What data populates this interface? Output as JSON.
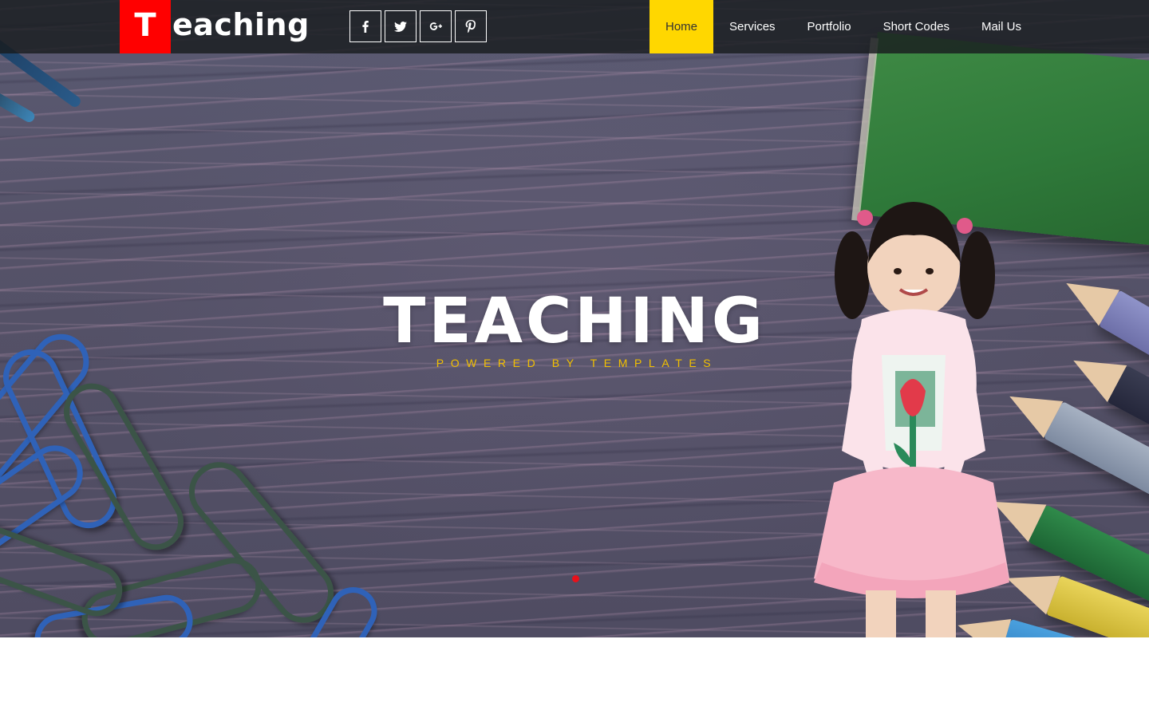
{
  "brand": {
    "logo_initial": "T",
    "logo_rest": "eaching",
    "accent_color": "#ff0000"
  },
  "social": [
    {
      "name": "facebook-icon",
      "label": "f"
    },
    {
      "name": "twitter-icon",
      "label": ""
    },
    {
      "name": "google-plus-icon",
      "label": "g+"
    },
    {
      "name": "pinterest-icon",
      "label": ""
    }
  ],
  "nav": {
    "items": [
      {
        "label": "Home",
        "active": true
      },
      {
        "label": "Services",
        "active": false
      },
      {
        "label": "Portfolio",
        "active": false
      },
      {
        "label": "Short Codes",
        "active": false
      },
      {
        "label": "Mail Us",
        "active": false
      }
    ],
    "active_color": "#ffd700"
  },
  "hero": {
    "title": "TEACHING",
    "subtitle": "POWERED BY TEMPLATES",
    "subtitle_color": "#f2c000",
    "slider_dot_color": "#e8111b"
  }
}
